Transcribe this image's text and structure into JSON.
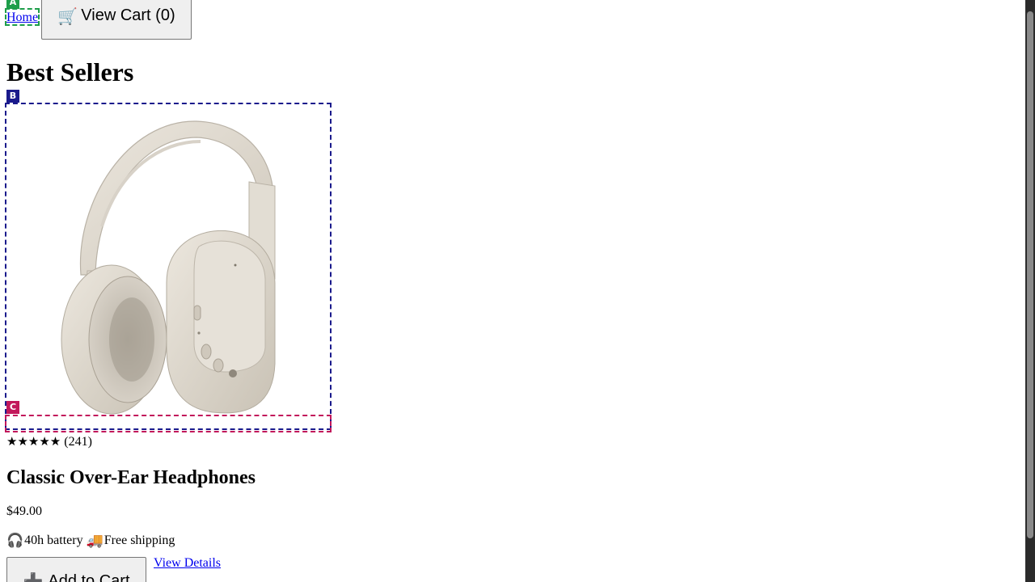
{
  "nav": {
    "home_label": "Home",
    "cart_icon": "🛒",
    "cart_label": "View Cart (0)"
  },
  "page": {
    "title": "Best Sellers"
  },
  "product": {
    "image_description_icon": "headphones-image",
    "stars": "★★★★★",
    "review_count": "(241)",
    "name": "Classic Over-Ear Headphones",
    "price": "$49.00",
    "features": [
      {
        "icon": "🎧",
        "icon_name": "headphones-icon",
        "label": "40h battery"
      },
      {
        "icon": "🚚",
        "icon_name": "delivery-truck-icon",
        "label": "Free shipping"
      }
    ],
    "add_icon": "➕",
    "add_label": "Add to Cart",
    "details_label": "View Details"
  },
  "annotations": [
    {
      "label": "A",
      "color": "#1e9e4a"
    },
    {
      "label": "B",
      "color": "#1a1a8c"
    },
    {
      "label": "C",
      "color": "#c2185b"
    }
  ]
}
